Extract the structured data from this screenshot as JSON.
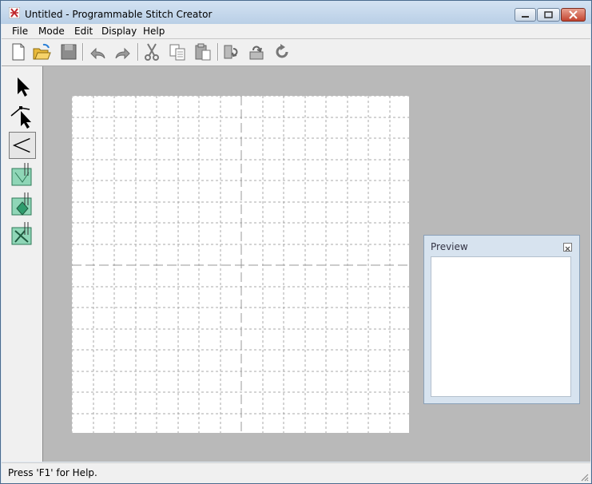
{
  "window": {
    "title": "Untitled - Programmable Stitch Creator"
  },
  "menu": {
    "items": [
      "File",
      "Mode",
      "Edit",
      "Display",
      "Help"
    ]
  },
  "toolbar": {
    "buttons": [
      "new-icon",
      "open-icon",
      "save-icon",
      "undo-icon",
      "redo-icon",
      "cut-icon",
      "copy-icon",
      "paste-icon",
      "flip-horizontal-icon",
      "flip-vertical-icon",
      "rotate-icon"
    ]
  },
  "toolbox": {
    "tools": [
      "select-arrow-icon",
      "point-select-icon",
      "zigzag-stitch-icon",
      "stitch-tool-1-icon",
      "stitch-tool-2-icon",
      "stitch-tool-3-icon"
    ],
    "selected": "zigzag-stitch-icon"
  },
  "preview": {
    "title": "Preview"
  },
  "status": {
    "text": "Press 'F1' for Help."
  },
  "colors": {
    "canvas_bg": "#b9b9b9",
    "grid_line": "#a8a8a8",
    "titlebar": "#c6d8ec"
  }
}
